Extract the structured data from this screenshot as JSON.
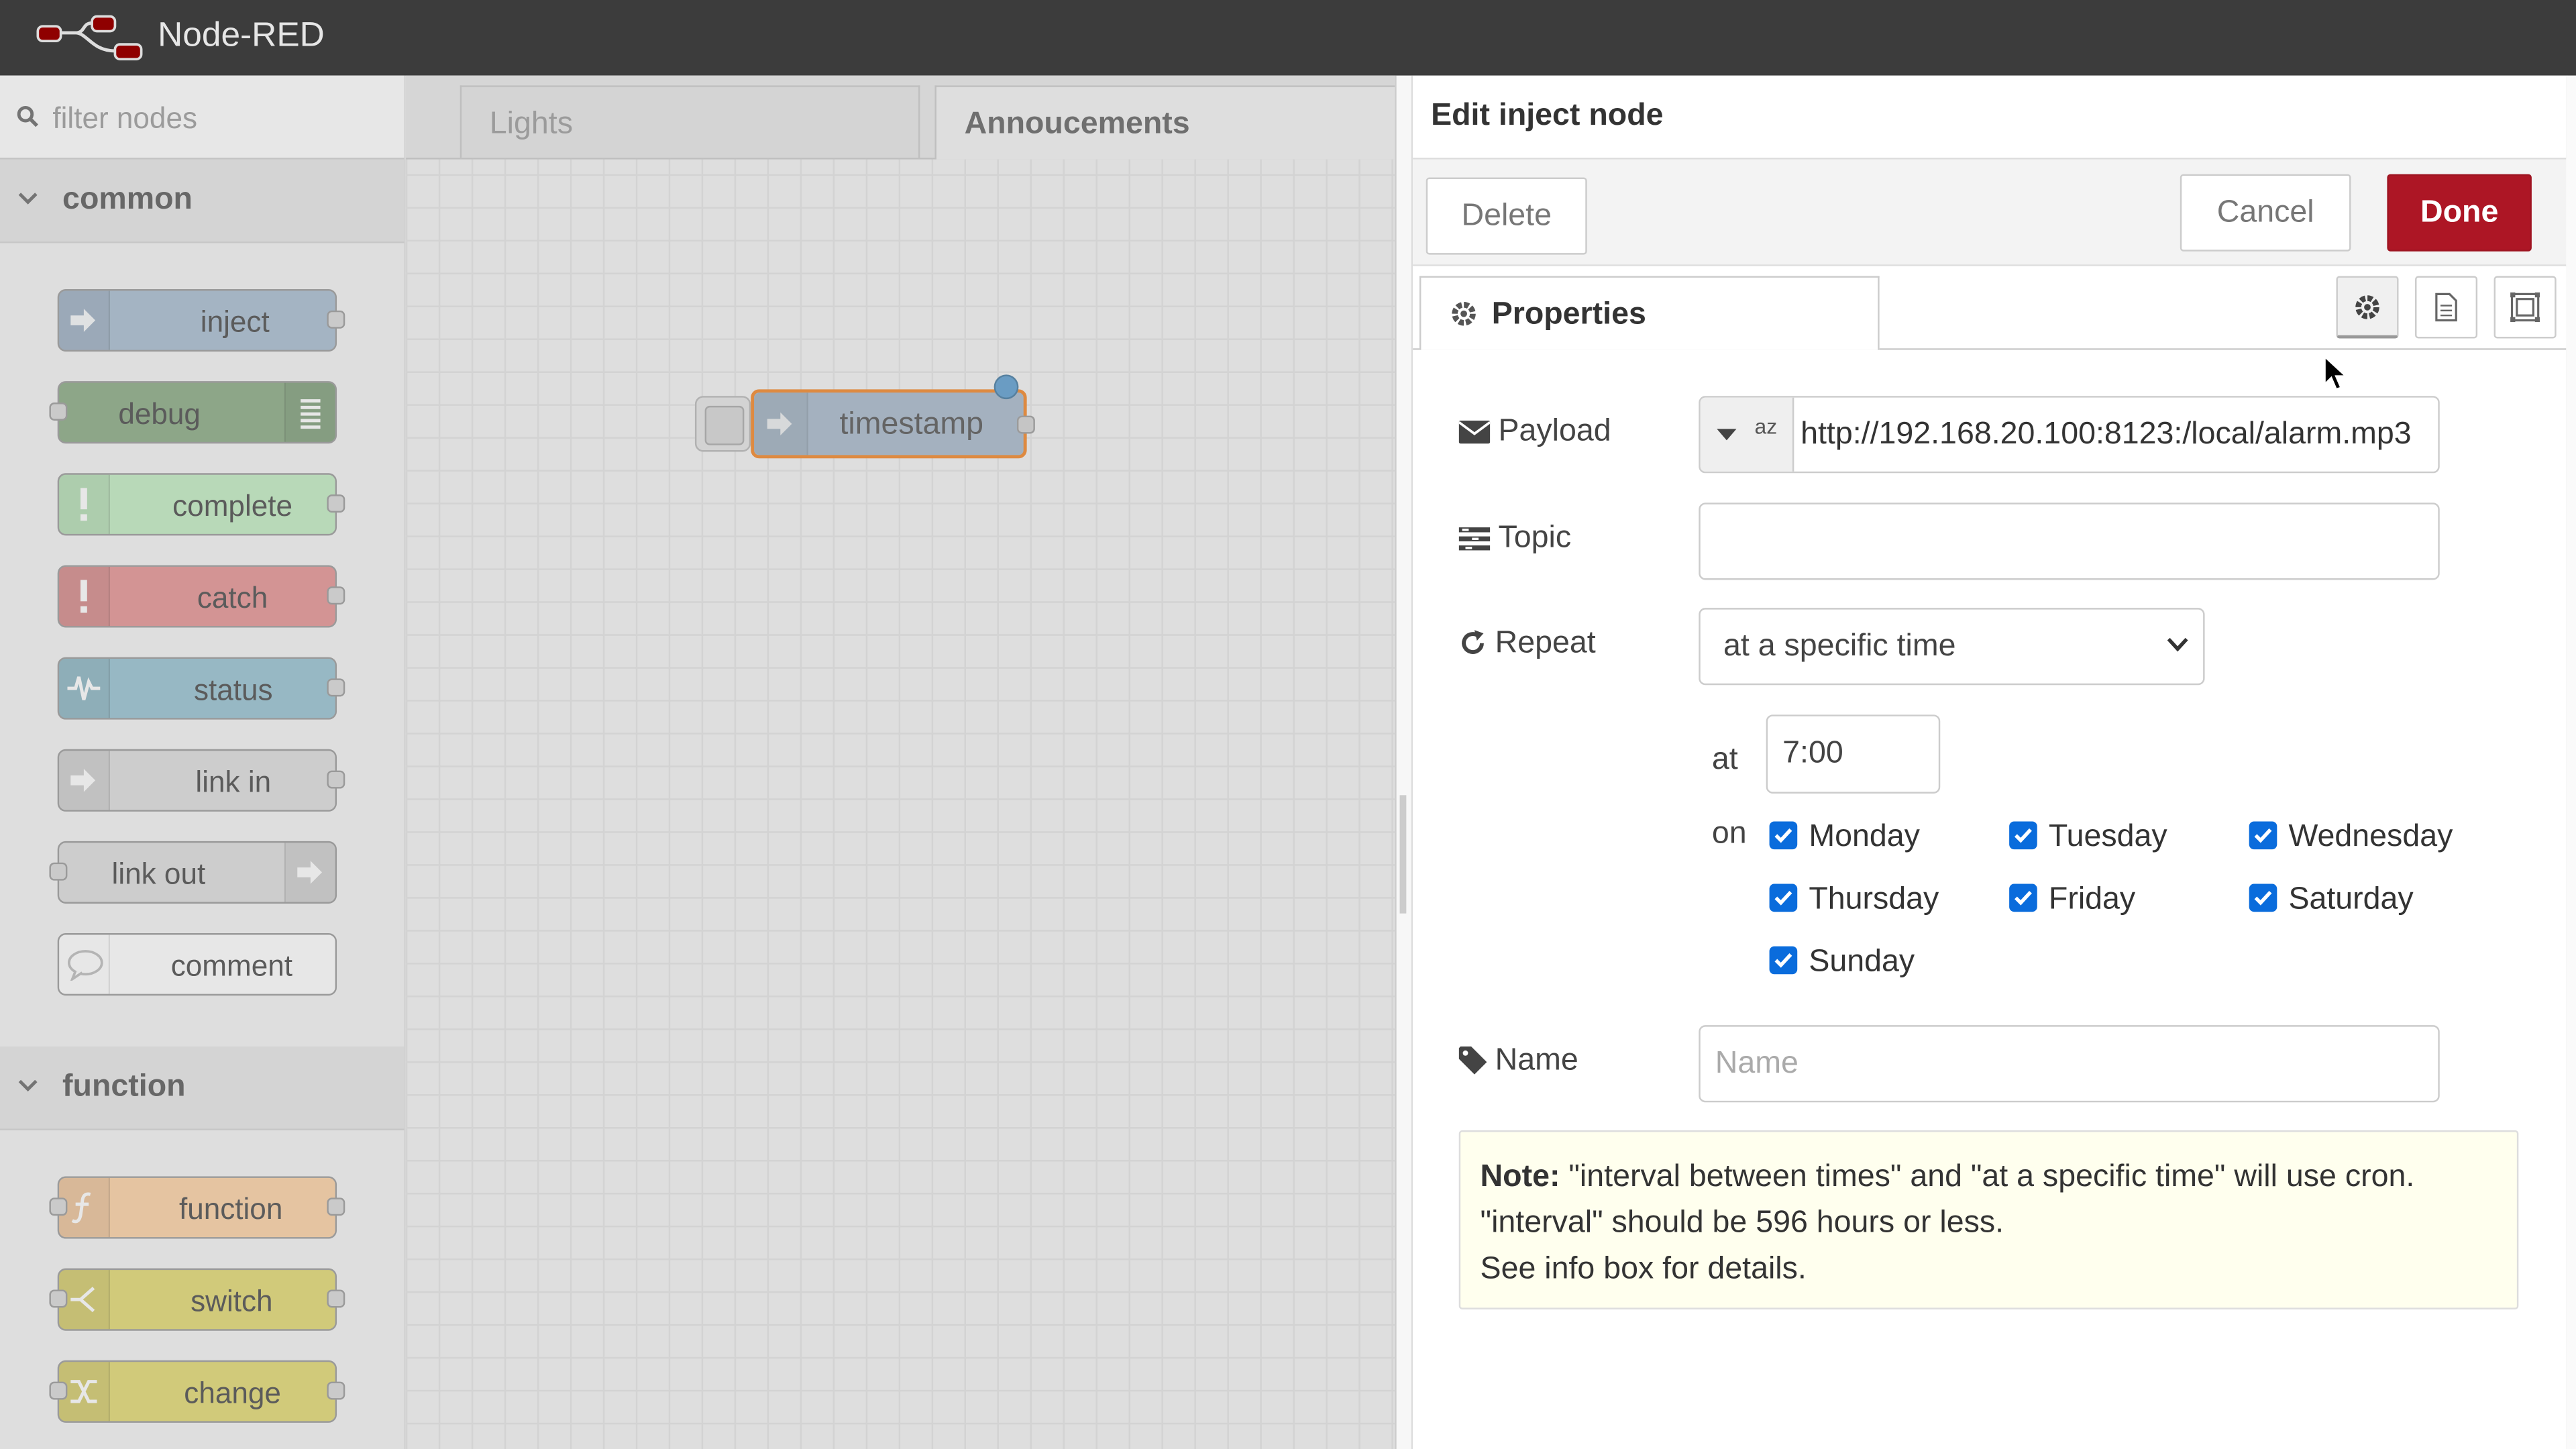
{
  "header": {
    "title": "Node-RED"
  },
  "palette": {
    "filter_placeholder": "filter nodes",
    "categories": [
      {
        "label": "common",
        "nodes": [
          "inject",
          "debug",
          "complete",
          "catch",
          "status",
          "link in",
          "link out",
          "comment"
        ]
      },
      {
        "label": "function",
        "nodes": [
          "function",
          "switch",
          "change"
        ]
      }
    ]
  },
  "workspace": {
    "tabs": [
      "Lights",
      "Annoucements"
    ],
    "active_tab": "Annoucements",
    "flow_node": {
      "label": "timestamp",
      "color": "#a6bbcf"
    }
  },
  "tray": {
    "title": "Edit inject node",
    "buttons": {
      "delete": "Delete",
      "cancel": "Cancel",
      "done": "Done"
    },
    "tab_label": "Properties",
    "form": {
      "payload_label": "Payload",
      "payload_type": "az",
      "payload_value": "http://192.168.20.100:8123:/local/alarm.mp3",
      "topic_label": "Topic",
      "topic_value": "",
      "repeat_label": "Repeat",
      "repeat_value": "at a specific time",
      "at_label": "at",
      "time_value": "7:00",
      "on_label": "on",
      "days": [
        "Monday",
        "Tuesday",
        "Wednesday",
        "Thursday",
        "Friday",
        "Saturday",
        "Sunday"
      ],
      "days_checked": [
        true,
        true,
        true,
        true,
        true,
        true,
        true
      ],
      "name_label": "Name",
      "name_placeholder": "Name"
    },
    "note": {
      "bold": "Note:",
      "line1": " \"interval between times\" and \"at a specific time\" will use cron.",
      "line2": "\"interval\" should be 596 hours or less.",
      "line3": "See info box for details."
    }
  },
  "colors": {
    "header_bg": "#3c3c3c",
    "done_button": "#ad1625",
    "selected_outline": "#ff7f0e",
    "checkbox": "#0a6cdc",
    "inject": "#a6bbcf",
    "debug": "#87a980",
    "complete": "#c0edc0",
    "catch": "#e49191",
    "status": "#94c1d0",
    "link": "#dddddd",
    "comment": "#ffffff",
    "function": "#fdd0a2",
    "switch": "#e2d96e"
  }
}
